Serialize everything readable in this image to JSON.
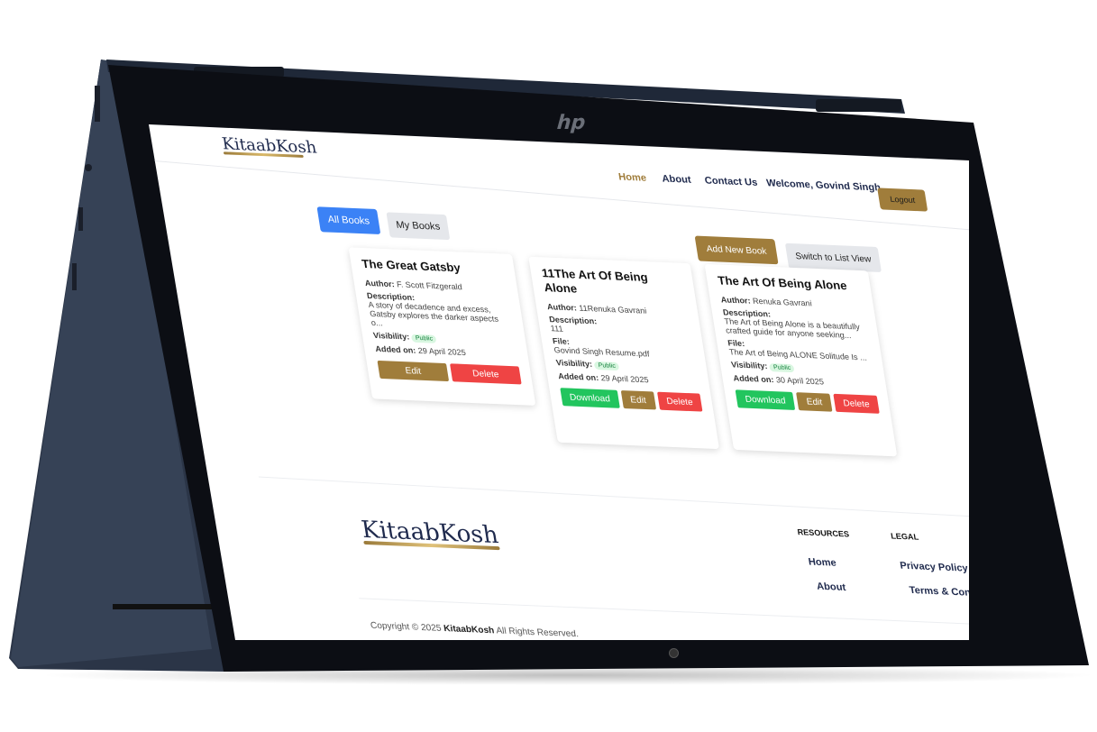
{
  "header": {
    "logo_text": "KitaabKosh",
    "nav": [
      "Home",
      "About",
      "Contact Us",
      "Welcome, Govind Singh"
    ],
    "logout_label": "Logout"
  },
  "toolbar": {
    "tab_all": "All Books",
    "tab_my": "My Books",
    "add_new": "Add New Book",
    "switch_view": "Switch to List View"
  },
  "books": [
    {
      "title": "The Great Gatsby",
      "author_label": "Author:",
      "author": "F. Scott Fitzgerald",
      "desc_label": "Description:",
      "description": "A story of decadence and excess, Gatsby explores the darker aspects o...",
      "visibility_label": "Visibility:",
      "visibility": "Public",
      "added_label": "Added on:",
      "added": "29 April 2025",
      "edit": "Edit",
      "delete": "Delete"
    },
    {
      "title": "11The Art Of Being Alone",
      "author_label": "Author:",
      "author": "11Renuka Gavrani",
      "desc_label": "Description:",
      "description": "111",
      "file_label": "File:",
      "file": "Govind Singh Resume.pdf",
      "visibility_label": "Visibility:",
      "visibility": "Public",
      "added_label": "Added on:",
      "added": "29 April 2025",
      "download": "Download",
      "edit": "Edit",
      "delete": "Delete"
    },
    {
      "title": "The Art Of Being Alone",
      "author_label": "Author:",
      "author": "Renuka Gavrani",
      "desc_label": "Description:",
      "description": "The Art of Being Alone is a beautifully crafted guide for anyone seeking...",
      "file_label": "File:",
      "file": "The Art of Being ALONE Solitude Is ...",
      "visibility_label": "Visibility:",
      "visibility": "Public",
      "added_label": "Added on:",
      "added": "30 April 2025",
      "download": "Download",
      "edit": "Edit",
      "delete": "Delete"
    }
  ],
  "footer": {
    "logo_text": "KitaabKosh",
    "resources_heading": "RESOURCES",
    "resources": [
      "Home",
      "About"
    ],
    "legal_heading": "LEGAL",
    "legal": [
      "Privacy Policy",
      "Terms & Conditions"
    ],
    "copyright_prefix": "Copyright © 2025",
    "copyright_brand": "KitaabKosh",
    "copyright_suffix": "All Rights Reserved."
  },
  "device": {
    "brand_mark": "hp"
  },
  "colors": {
    "accent_gold": "#a07d3b",
    "primary_blue": "#3b82f6",
    "danger_red": "#ef4444",
    "success_green": "#22c55e",
    "navy": "#1f2a4d"
  }
}
